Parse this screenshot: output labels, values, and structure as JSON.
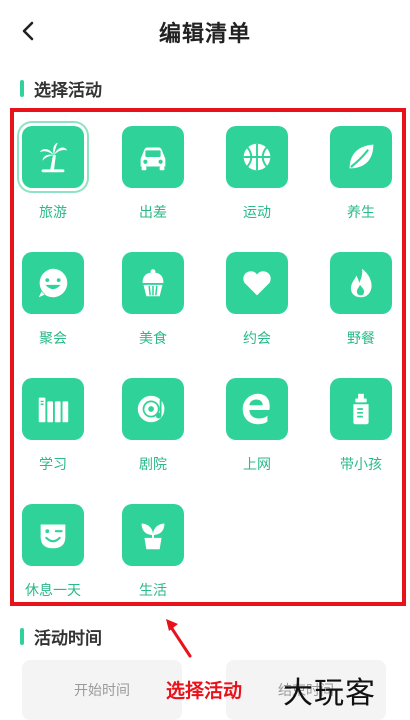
{
  "header": {
    "title": "编辑清单"
  },
  "section_activity": {
    "title": "选择活动"
  },
  "activities": [
    {
      "label": "旅游",
      "icon": "palm-tree-icon"
    },
    {
      "label": "出差",
      "icon": "car-icon"
    },
    {
      "label": "运动",
      "icon": "basketball-icon"
    },
    {
      "label": "养生",
      "icon": "leaf-icon"
    },
    {
      "label": "聚会",
      "icon": "smiley-icon"
    },
    {
      "label": "美食",
      "icon": "cupcake-icon"
    },
    {
      "label": "约会",
      "icon": "heart-icon"
    },
    {
      "label": "野餐",
      "icon": "fire-icon"
    },
    {
      "label": "学习",
      "icon": "books-icon"
    },
    {
      "label": "剧院",
      "icon": "music-disc-icon"
    },
    {
      "label": "上网",
      "icon": "browser-e-icon"
    },
    {
      "label": "带小孩",
      "icon": "baby-bottle-icon"
    },
    {
      "label": "休息一天",
      "icon": "wink-face-icon"
    },
    {
      "label": "生活",
      "icon": "potted-plant-icon"
    }
  ],
  "section_time": {
    "title": "活动时间"
  },
  "time": {
    "start_label": "开始时间",
    "end_label": "结束时间"
  },
  "annotation": {
    "caption": "选择活动",
    "watermark": "大玩客"
  },
  "colors": {
    "accent": "#2fd39a",
    "label": "#2bb987",
    "annotation": "#e8121b"
  }
}
